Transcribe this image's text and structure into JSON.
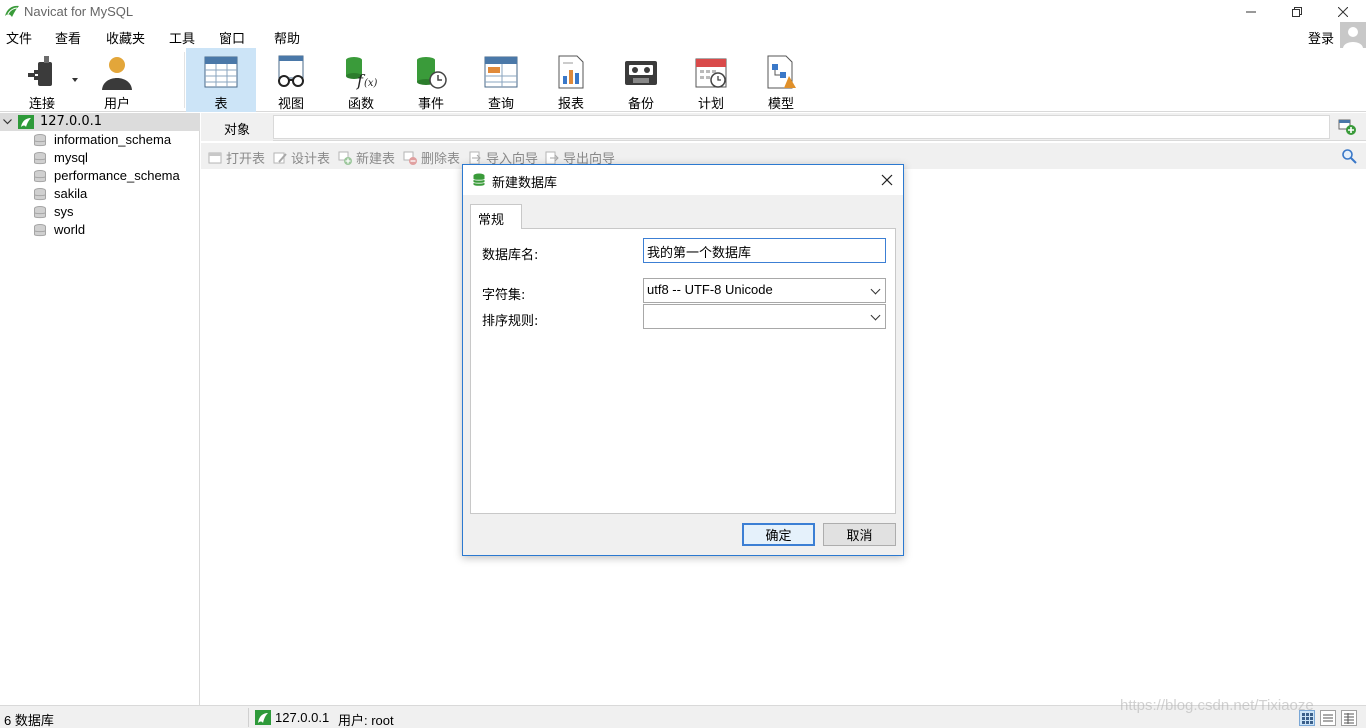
{
  "window": {
    "title": "Navicat for MySQL"
  },
  "menu": {
    "items": [
      "文件",
      "查看",
      "收藏夹",
      "工具",
      "窗口",
      "帮助"
    ],
    "login": "登录"
  },
  "toolbar": {
    "connect": "连接",
    "user": "用户",
    "table": "表",
    "view": "视图",
    "function": "函数",
    "event": "事件",
    "query": "查询",
    "report": "报表",
    "backup": "备份",
    "schedule": "计划",
    "model": "模型"
  },
  "tree": {
    "connection": "127.0.0.1",
    "databases": [
      "information_schema",
      "mysql",
      "performance_schema",
      "sakila",
      "sys",
      "world"
    ]
  },
  "main": {
    "tab_object": "对象",
    "actions": {
      "open_table": "打开表",
      "design_table": "设计表",
      "new_table": "新建表",
      "delete_table": "删除表",
      "import_wizard": "导入向导",
      "export_wizard": "导出向导"
    }
  },
  "dialog": {
    "title": "新建数据库",
    "tab": "常规",
    "db_name_label": "数据库名:",
    "db_name_value": "我的第一个数据库",
    "charset_label": "字符集:",
    "charset_value": "utf8 -- UTF-8 Unicode",
    "collation_label": "排序规则:",
    "collation_value": "",
    "ok": "确定",
    "cancel": "取消"
  },
  "status": {
    "db_count": "6 数据库",
    "connection": "127.0.0.1",
    "user": "用户: root"
  },
  "watermark": "https://blog.csdn.net/Tixiaoze",
  "colors": {
    "accent": "#2b79d0",
    "selected_bg": "#cce4f7",
    "green": "#2e9a3a"
  }
}
